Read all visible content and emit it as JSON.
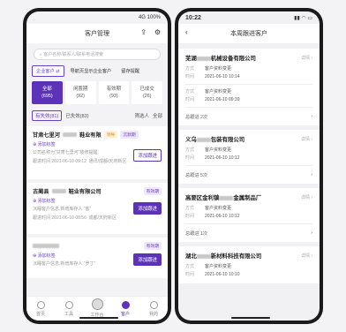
{
  "left": {
    "status": {
      "time": "",
      "right": "4G 100%"
    },
    "title": "客户管理",
    "search_placeholder": "客户名称/联系人/联系电话搜索",
    "chips": [
      "企业客户 ⇄",
      "导航页显示企业客户",
      "留存提醒"
    ],
    "stats": [
      {
        "label": "全部",
        "count": "(695)"
      },
      {
        "label": "闲置期",
        "count": "(92)"
      },
      {
        "label": "有效期",
        "count": "(93)"
      },
      {
        "label": "已成交",
        "count": "(26)"
      }
    ],
    "filter": {
      "a": "有失效(81)",
      "b": "已失效(83)",
      "c": "筛选人",
      "d": "全部"
    },
    "cards": [
      {
        "name": "甘肃七里河",
        "name2": "鞋业有限",
        "tag": "领导",
        "tag2": "沉默期",
        "add": "添加标签",
        "note": "公司名称为“甘肃七里河”装修提醒",
        "date": "跟进时间 2021-06-10 09:12",
        "loc": "通讯/成都/天府新区",
        "btn": "添加跟进"
      },
      {
        "name": "古蔺县",
        "name2": "鞋业有限公司",
        "tag2": "有效期",
        "add": "添加标签",
        "note": "沉睡客户信息,新增库存人 “客”",
        "date": "跟进时间 2021-06-10 08:56",
        "loc": "成都/天府新区",
        "btn": "添加跟进"
      },
      {
        "name": "",
        "tag2": "有效期",
        "add": "添加标签",
        "note": "沉睡客户信息,新增库存人 “罗丁”",
        "date": "",
        "loc": "",
        "btn": "添加跟进"
      }
    ],
    "tabs": [
      "首页",
      "工具",
      "工作台",
      "客户",
      "我的"
    ]
  },
  "right": {
    "status": {
      "time": "10:22"
    },
    "title": "本周跟进客户",
    "items": [
      {
        "name": "芜湖",
        "name2": "机械设备有限公司",
        "rows": [
          [
            "方式",
            "客户资料变更"
          ],
          [
            "时间",
            "2021-06-10 10:14"
          ]
        ],
        "rows2": [
          [
            "方式",
            "客户资料变更"
          ],
          [
            "时间",
            "2021-06-10 09:39"
          ]
        ],
        "count": "总跟进 2次"
      },
      {
        "name": "义乌",
        "name2": "包装有限公司",
        "rows": [
          [
            "方式",
            "客户资料变更"
          ],
          [
            "时间",
            "2021-06-10 10:12"
          ]
        ],
        "count": "总跟进 5次"
      },
      {
        "name": "高要区金利镇",
        "name2": "金属制品厂",
        "rows": [
          [
            "方式",
            "客户资料变更"
          ],
          [
            "时间",
            "2021-06-10 10:12"
          ]
        ],
        "count": "总跟进 1次"
      },
      {
        "name": "湖北",
        "name2": "新材料科技有限公司",
        "rows": [
          [
            "方式",
            "客户资料变更"
          ],
          [
            "时间",
            "2021-06-10 10:10"
          ]
        ],
        "count": ""
      }
    ],
    "detail": "详情 ›"
  }
}
